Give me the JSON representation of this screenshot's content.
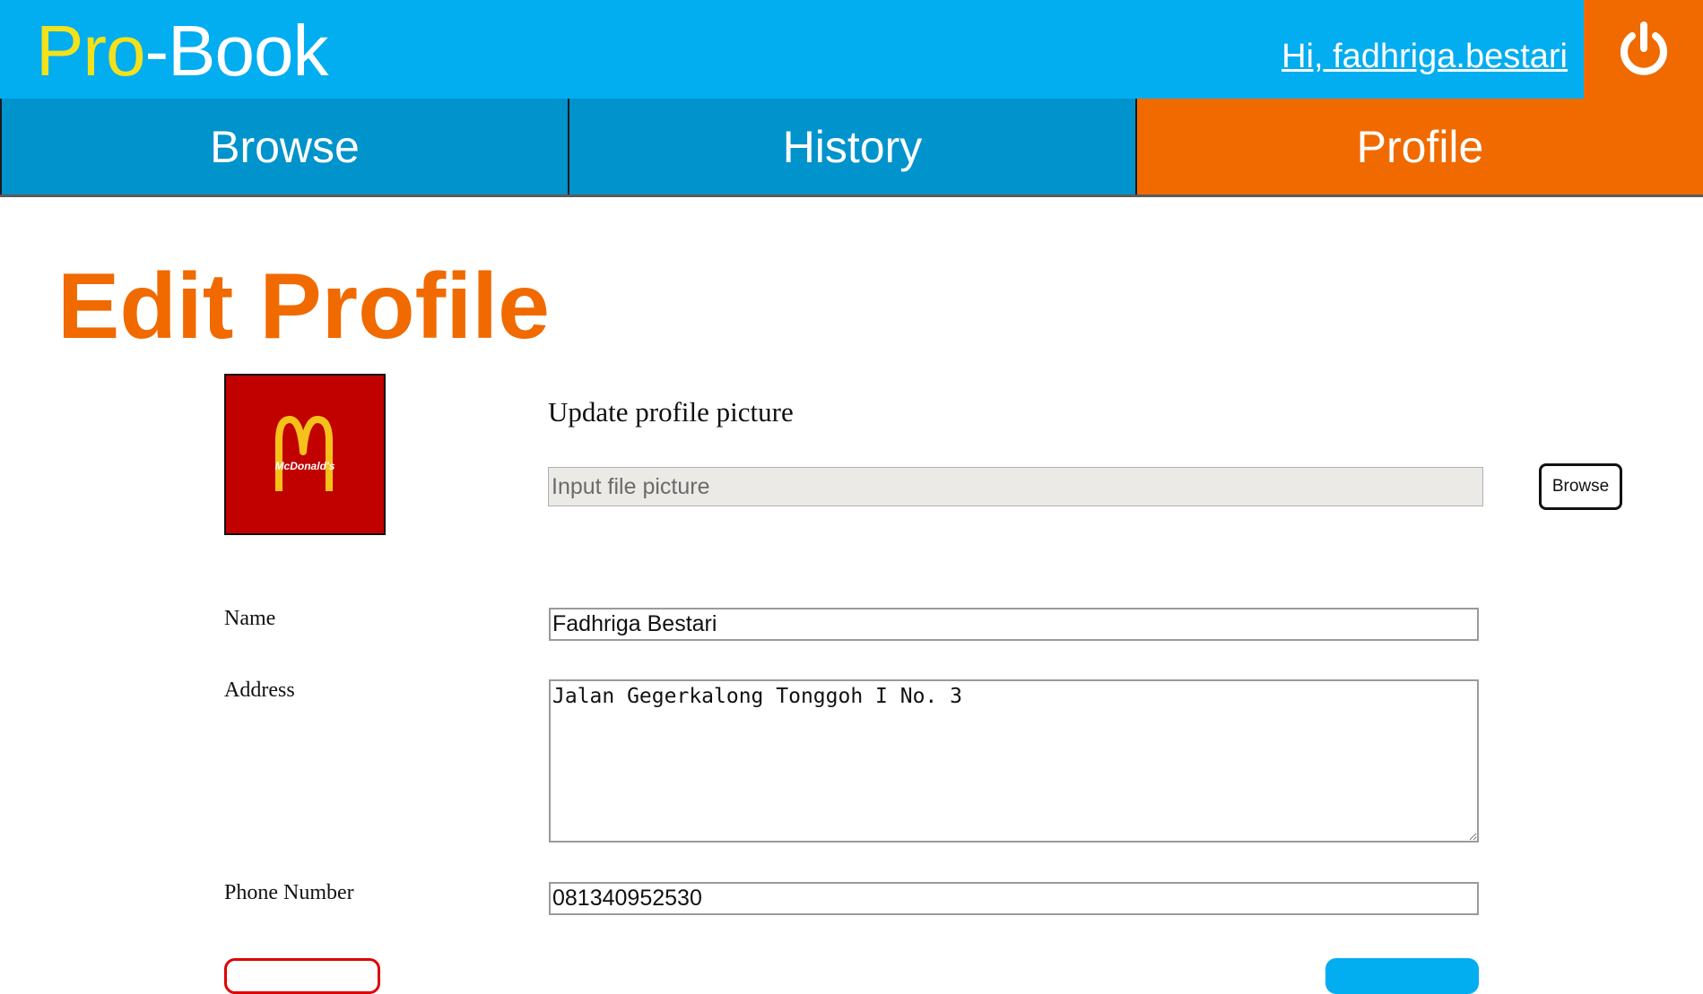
{
  "header": {
    "brand_first": "Pro",
    "brand_rest": "-Book",
    "greeting": "Hi, fadhriga.bestari",
    "logout_icon": "power-icon"
  },
  "nav": {
    "tabs": [
      {
        "label": "Browse",
        "active": false
      },
      {
        "label": "History",
        "active": false
      },
      {
        "label": "Profile",
        "active": true
      }
    ]
  },
  "page": {
    "title": "Edit Profile"
  },
  "profile_picture": {
    "logo_text": "McDonald's",
    "upload_label": "Update profile picture",
    "file_placeholder": "Input file picture",
    "browse_label": "Browse"
  },
  "form": {
    "name_label": "Name",
    "name_value": "Fadhriga Bestari",
    "address_label": "Address",
    "address_value": "Jalan Gegerkalong Tonggoh I No. 3",
    "phone_label": "Phone Number",
    "phone_value": "081340952530"
  },
  "colors": {
    "header_blue": "#02adf0",
    "tab_blue": "#0193cb",
    "accent_orange": "#f06a00",
    "brand_yellow": "#f3e11b",
    "avatar_red": "#c10000",
    "back_button_border": "#e00000"
  }
}
